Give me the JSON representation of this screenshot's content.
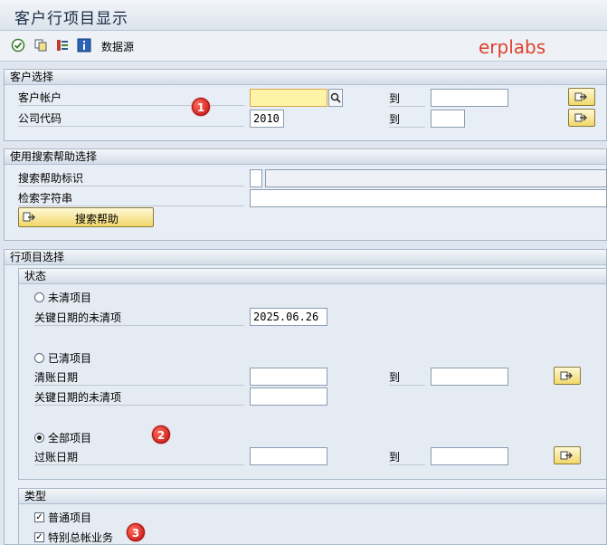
{
  "window": {
    "title": "客户行项目显示"
  },
  "toolbar": {
    "data_source_label": "数据源",
    "brand": "erplabs"
  },
  "customer_selection": {
    "title": "客户选择",
    "customer_account_label": "客户帐户",
    "customer_account_value": "",
    "company_code_label": "公司代码",
    "company_code_value": "2010",
    "to_label": "到"
  },
  "search_help": {
    "title": "使用搜索帮助选择",
    "search_help_id_label": "搜索帮助标识",
    "search_string_label": "检索字符串",
    "button_label": "搜索帮助"
  },
  "line_item_selection": {
    "title": "行项目选择",
    "status": {
      "title": "状态",
      "open_items_label": "未清项目",
      "open_key_date_label": "关键日期的未清项",
      "open_key_date_value": "2025.06.26",
      "cleared_items_label": "已清项目",
      "clearing_date_label": "清账日期",
      "cleared_key_date_label": "关键日期的未清项",
      "all_items_label": "全部项目",
      "posting_date_label": "过账日期",
      "to_label": "到",
      "selected": "all_items"
    },
    "type": {
      "title": "类型",
      "normal_items_label": "普通项目",
      "normal_items_checked": true,
      "special_gl_label": "特别总帐业务",
      "special_gl_checked": true
    }
  },
  "annotations": {
    "marker1": "1",
    "marker2": "2",
    "marker3": "3"
  }
}
